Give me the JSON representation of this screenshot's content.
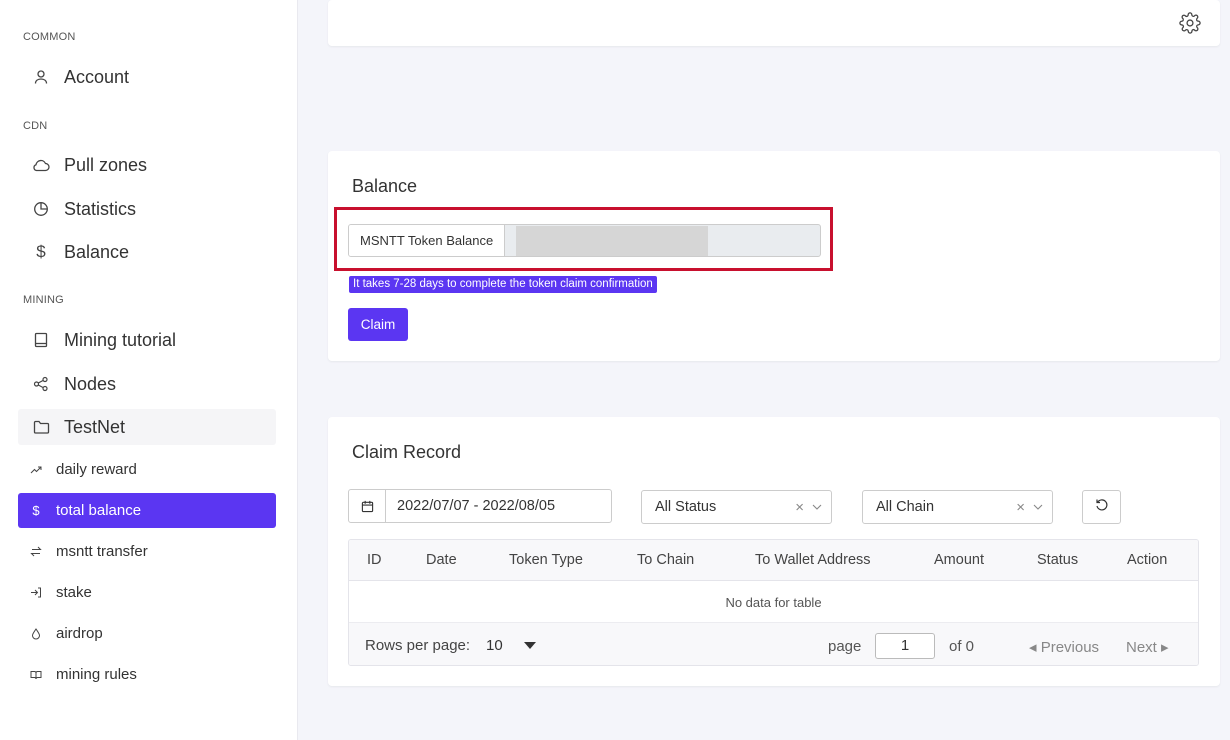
{
  "sidebar": {
    "sections": {
      "common": "COMMON",
      "cdn": "CDN",
      "mining": "MINING"
    },
    "items": {
      "account": "Account",
      "pull_zones": "Pull zones",
      "statistics": "Statistics",
      "balance": "Balance",
      "mining_tutorial": "Mining tutorial",
      "nodes": "Nodes",
      "testnet": "TestNet",
      "daily_reward": "daily reward",
      "total_balance": "total balance",
      "msntt_transfer": "msntt transfer",
      "stake": "stake",
      "airdrop": "airdrop",
      "mining_rules": "mining rules"
    },
    "dollar_icon_glyph": "$"
  },
  "balance_card": {
    "title": "Balance",
    "token_label": "MSNTT Token Balance",
    "note": "It takes 7-28 days to complete the token claim confirmation",
    "claim_label": "Claim"
  },
  "claim_record": {
    "title": "Claim Record",
    "date_range": "2022/07/07 - 2022/08/05",
    "status_select": "All Status",
    "chain_select": "All Chain",
    "columns": [
      "ID",
      "Date",
      "Token Type",
      "To Chain",
      "To Wallet Address",
      "Amount",
      "Status",
      "Action"
    ],
    "empty_text": "No data for table",
    "footer": {
      "rows_per_page_label": "Rows per page:",
      "rows_per_page_value": "10",
      "page_label": "page",
      "page_value": "1",
      "of_label": "of 0",
      "previous_label": "◂ Previous",
      "next_label": "Next ▸"
    },
    "clear_glyph": "×"
  },
  "colors": {
    "accent": "#5b36f2",
    "highlight_border": "#c8102e",
    "background": "#f4f5fa"
  }
}
